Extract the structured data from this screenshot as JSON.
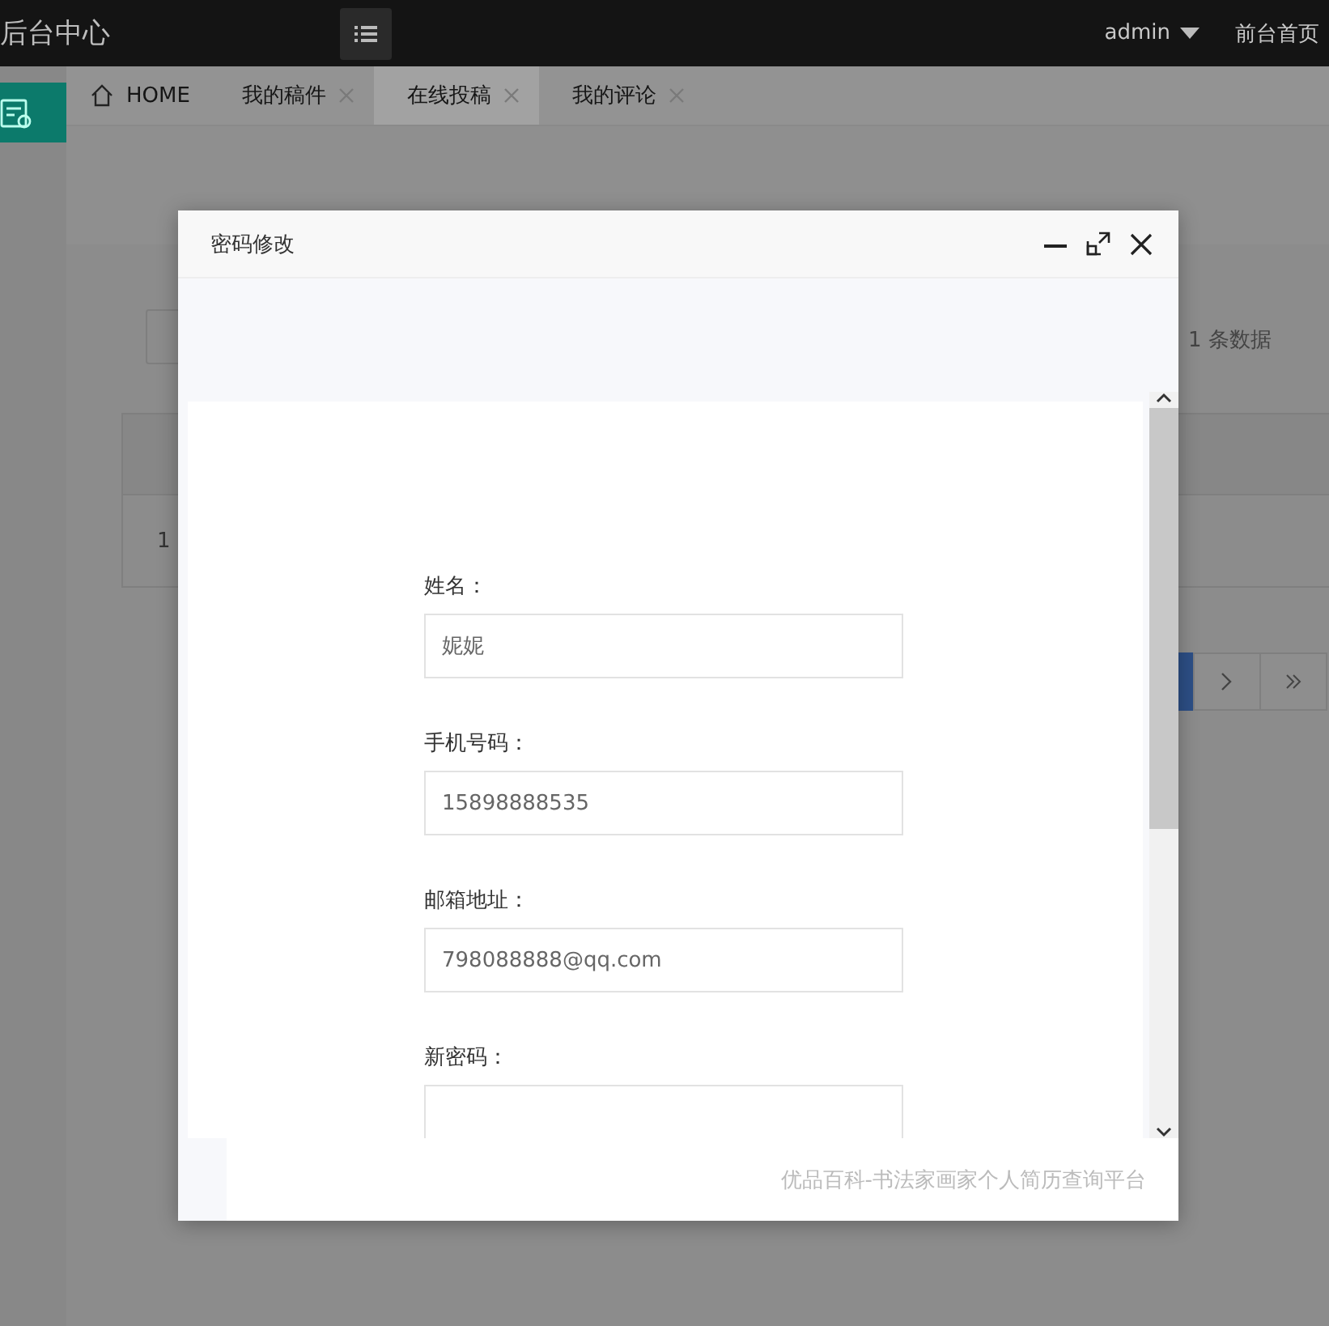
{
  "header": {
    "title": "后台中心",
    "user": "admin",
    "home_link": "前台首页"
  },
  "tabs": [
    {
      "label": "HOME",
      "kind": "home",
      "selected": false,
      "closable": false
    },
    {
      "label": "我的稿件",
      "kind": "page",
      "selected": false,
      "closable": true
    },
    {
      "label": "在线投稿",
      "kind": "page",
      "selected": true,
      "closable": true
    },
    {
      "label": "我的评论",
      "kind": "page",
      "selected": false,
      "closable": true
    }
  ],
  "background": {
    "record_count": "1 条数据",
    "table_rows": [
      {
        "index": "1"
      }
    ]
  },
  "dialog": {
    "title": "密码修改",
    "fields": [
      {
        "label": "姓名：",
        "value": "妮妮"
      },
      {
        "label": "手机号码：",
        "value": "15898888535"
      },
      {
        "label": "邮箱地址：",
        "value": "798088888@qq.com"
      },
      {
        "label": "新密码："
      }
    ],
    "footer": "优品百科-书法家画家个人简历查询平台"
  }
}
